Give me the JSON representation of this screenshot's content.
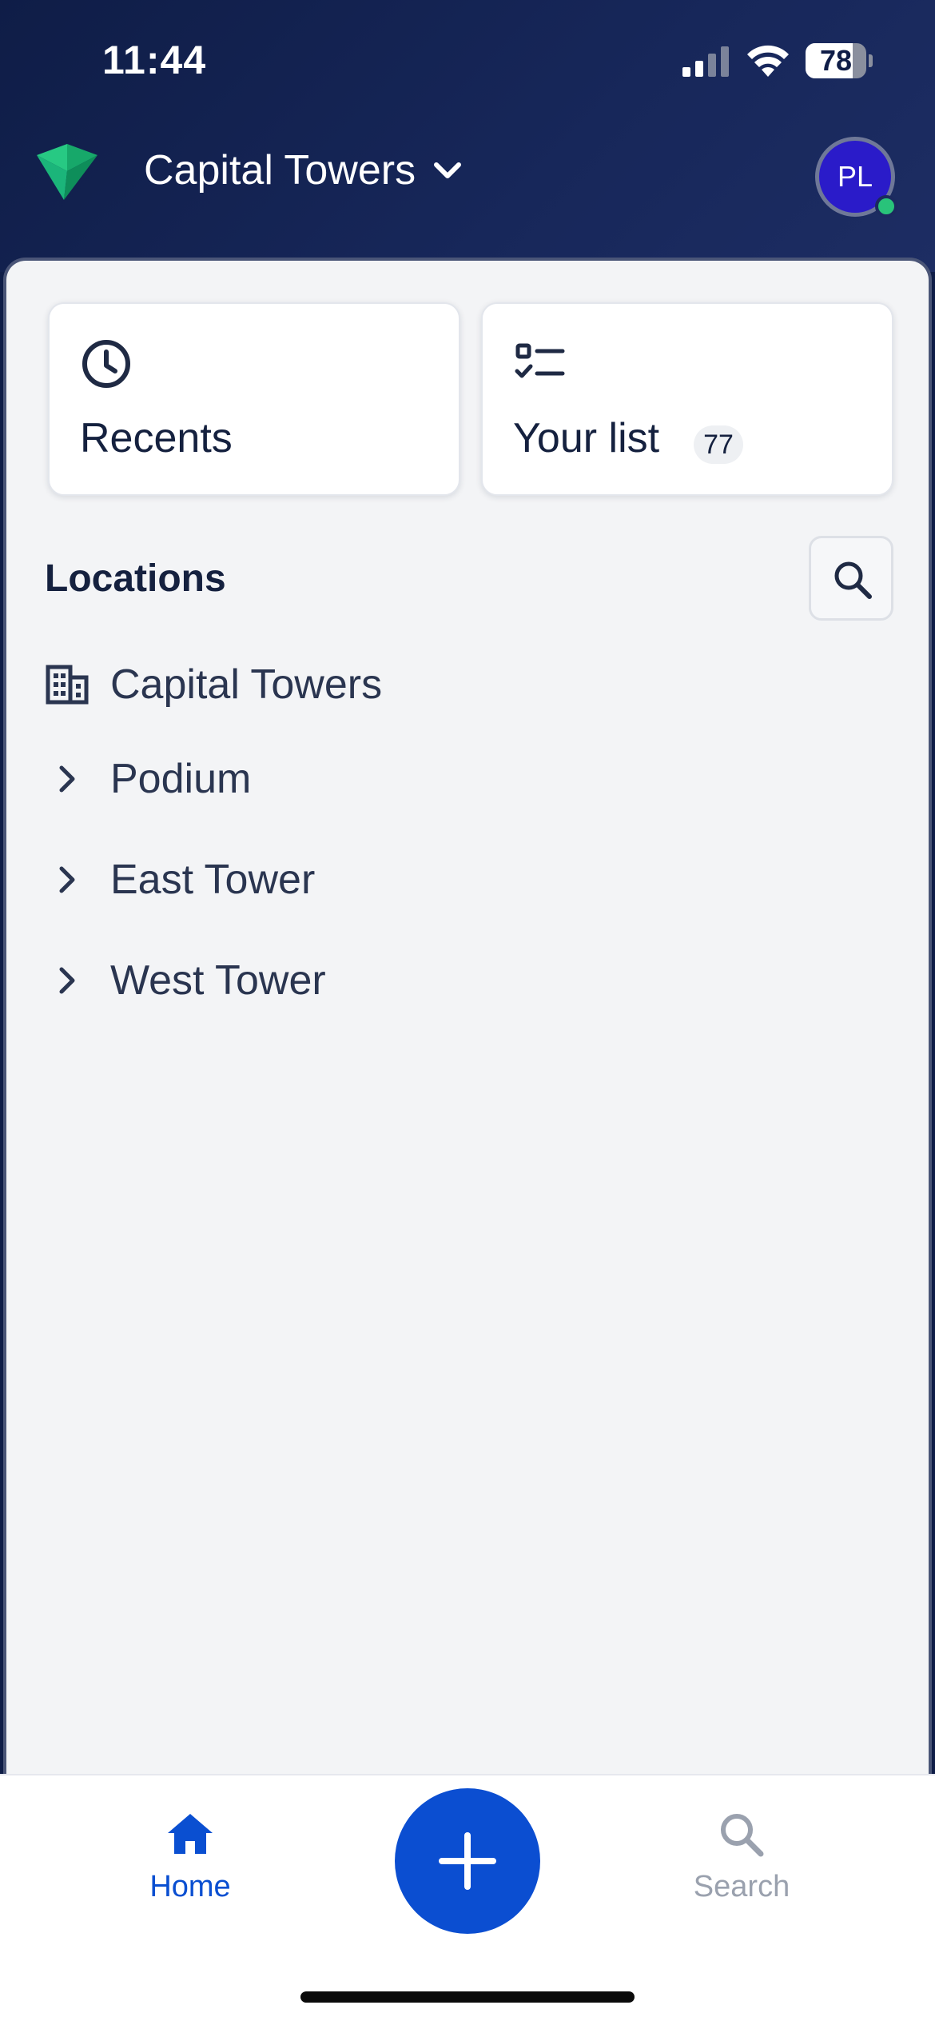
{
  "status_bar": {
    "time": "11:44",
    "battery_level": "78",
    "battery_fraction": 0.78,
    "icons": [
      "signal-icon",
      "wifi-icon",
      "battery-icon"
    ]
  },
  "header": {
    "site_name": "Capital Towers",
    "avatar_initials": "PL",
    "icons": [
      "app-logo-icon",
      "chevron-down-icon"
    ],
    "colors": {
      "background": "#0f1d47",
      "avatar": "#2a1bc9",
      "presence": "#29c37a",
      "logo": "#1bb57a"
    }
  },
  "cards": {
    "recents_label": "Recents",
    "your_list_label": "Your list",
    "your_list_count": "77",
    "icons": [
      "clock-icon",
      "checklist-icon"
    ]
  },
  "locations": {
    "heading": "Locations",
    "root": {
      "label": "Capital Towers",
      "icon": "building-icon"
    },
    "children": [
      {
        "label": "Podium",
        "icon": "chevron-right-icon"
      },
      {
        "label": "East Tower",
        "icon": "chevron-right-icon"
      },
      {
        "label": "West Tower",
        "icon": "chevron-right-icon"
      }
    ]
  },
  "bottom_nav": {
    "home_label": "Home",
    "search_label": "Search",
    "icons": [
      "home-icon",
      "plus-icon",
      "search-icon"
    ],
    "colors": {
      "active": "#0a4fd1",
      "inactive": "#9aa1ae",
      "fab": "#0b4ed1"
    }
  }
}
